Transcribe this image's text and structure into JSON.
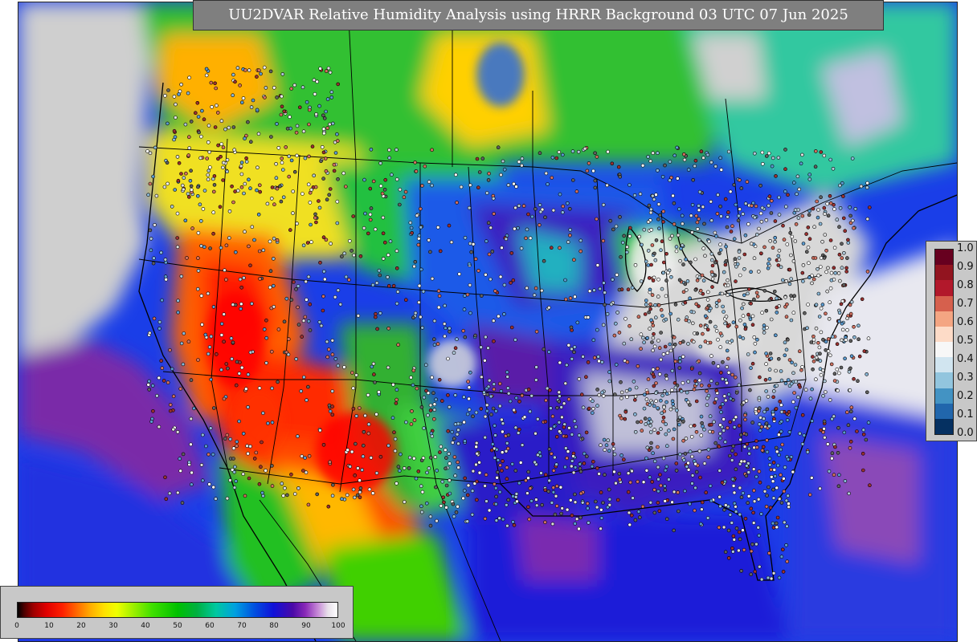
{
  "map": {
    "title": "UU2DVAR Relative Humidity Analysis using HRRR Background 03 UTC 07 Jun 2025",
    "variable": "Relative Humidity",
    "background_model": "HRRR",
    "valid_time": "03 UTC 07 Jun 2025",
    "region": "Continental United States (CONUS)"
  },
  "rh_colorbar": {
    "ticks": [
      "0",
      "10",
      "20",
      "30",
      "40",
      "50",
      "60",
      "70",
      "80",
      "90",
      "100"
    ],
    "range": [
      0,
      100
    ],
    "colors": [
      "#000000",
      "#a00000",
      "#ff2000",
      "#ffb000",
      "#f0ff00",
      "#40e000",
      "#00c000",
      "#00c8a0",
      "#0050e0",
      "#4a0aa8",
      "#ffffff"
    ]
  },
  "dot_legend": {
    "labels": [
      "1.0",
      "0.9",
      "0.8",
      "0.7",
      "0.6",
      "0.5",
      "0.4",
      "0.3",
      "0.2",
      "0.1",
      "0.0"
    ],
    "colors": [
      "#67001f",
      "#92141f",
      "#b2182b",
      "#d6604d",
      "#f4a582",
      "#fddbc7",
      "#f7f7f7",
      "#d1e5f0",
      "#92c5de",
      "#4393c3",
      "#2166ac",
      "#053061"
    ]
  }
}
